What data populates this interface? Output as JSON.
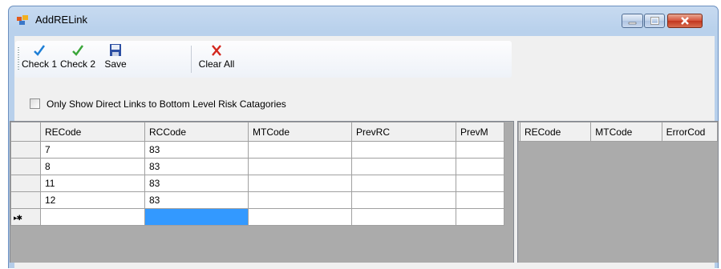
{
  "window": {
    "title": "AddRELink"
  },
  "toolbar": {
    "check1": "Check 1",
    "check2": "Check 2",
    "save": "Save",
    "clear_all": "Clear All"
  },
  "filter": {
    "only_direct_links_label": "Only Show Direct Links to Bottom Level Risk Catagories",
    "checked": false
  },
  "links_grid": {
    "columns": [
      "RECode",
      "RCCode",
      "MTCode",
      "PrevRC",
      "PrevM"
    ],
    "rows": [
      [
        "7",
        "83",
        "",
        "",
        ""
      ],
      [
        "8",
        "83",
        "",
        "",
        ""
      ],
      [
        "11",
        "83",
        "",
        "",
        ""
      ],
      [
        "12",
        "83",
        "",
        "",
        ""
      ]
    ],
    "new_row_glyph": "▸✱"
  },
  "errors_grid": {
    "columns": [
      "RECode",
      "MTCode",
      "ErrorCod"
    ]
  },
  "colors": {
    "selection": "#3399ff",
    "grid_empty": "#ababab"
  }
}
